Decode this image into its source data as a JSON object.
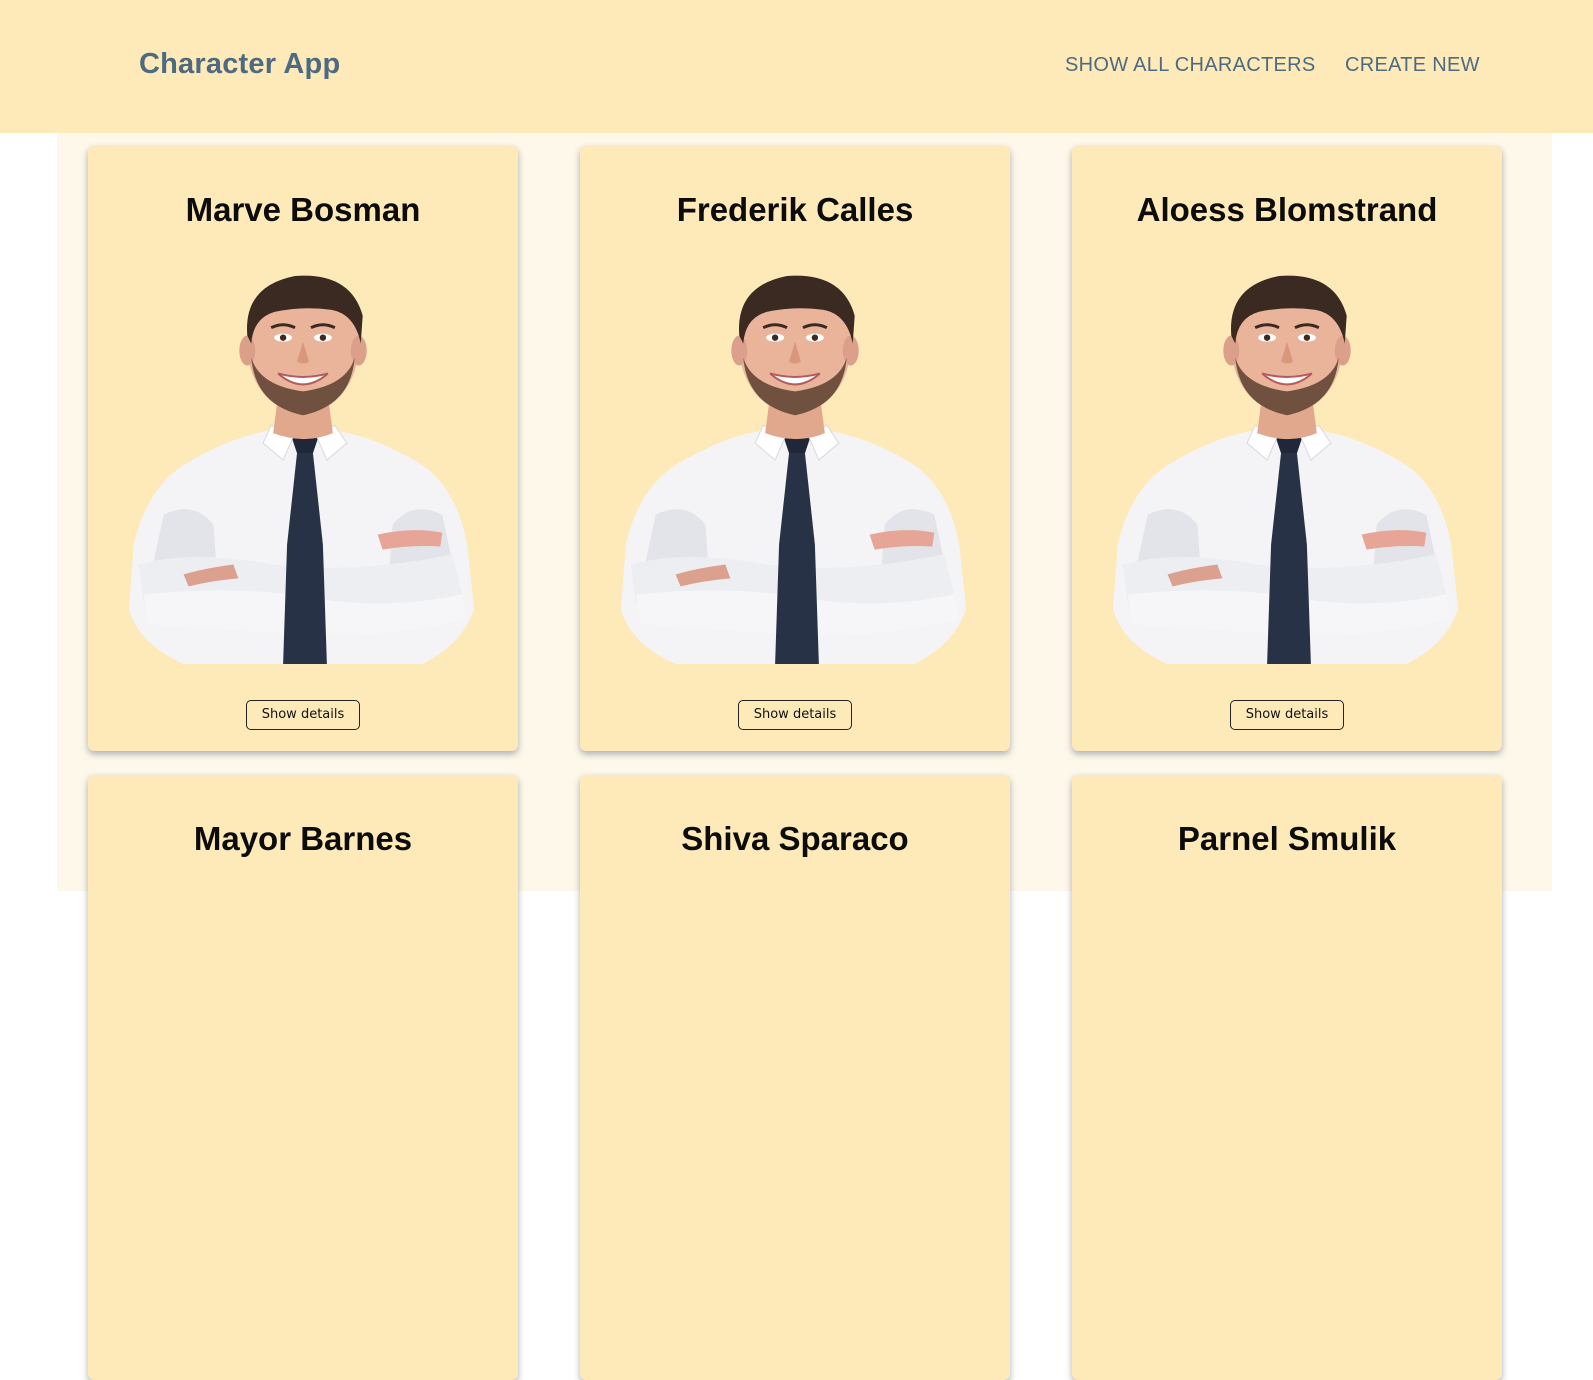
{
  "app": {
    "title": "Character App"
  },
  "nav": {
    "show_all": "SHOW ALL CHARACTERS",
    "create_new": "CREATE NEW"
  },
  "characters": [
    {
      "name": "Marve Bosman",
      "button": "Show details",
      "image": "portrait-man-white-shirt-dark-tie"
    },
    {
      "name": "Frederik Calles",
      "button": "Show details",
      "image": "portrait-man-white-shirt-dark-tie"
    },
    {
      "name": "Aloess Blomstrand",
      "button": "Show details",
      "image": "portrait-man-white-shirt-dark-tie"
    },
    {
      "name": "Mayor Barnes"
    },
    {
      "name": "Shiva Sparaco"
    },
    {
      "name": "Parnel Smulik"
    }
  ],
  "colors": {
    "navbar_bg": "#feeab9",
    "card_bg": "#feeab9",
    "page_bg": "#fdf8ea",
    "brand_text": "#4d6a80"
  }
}
